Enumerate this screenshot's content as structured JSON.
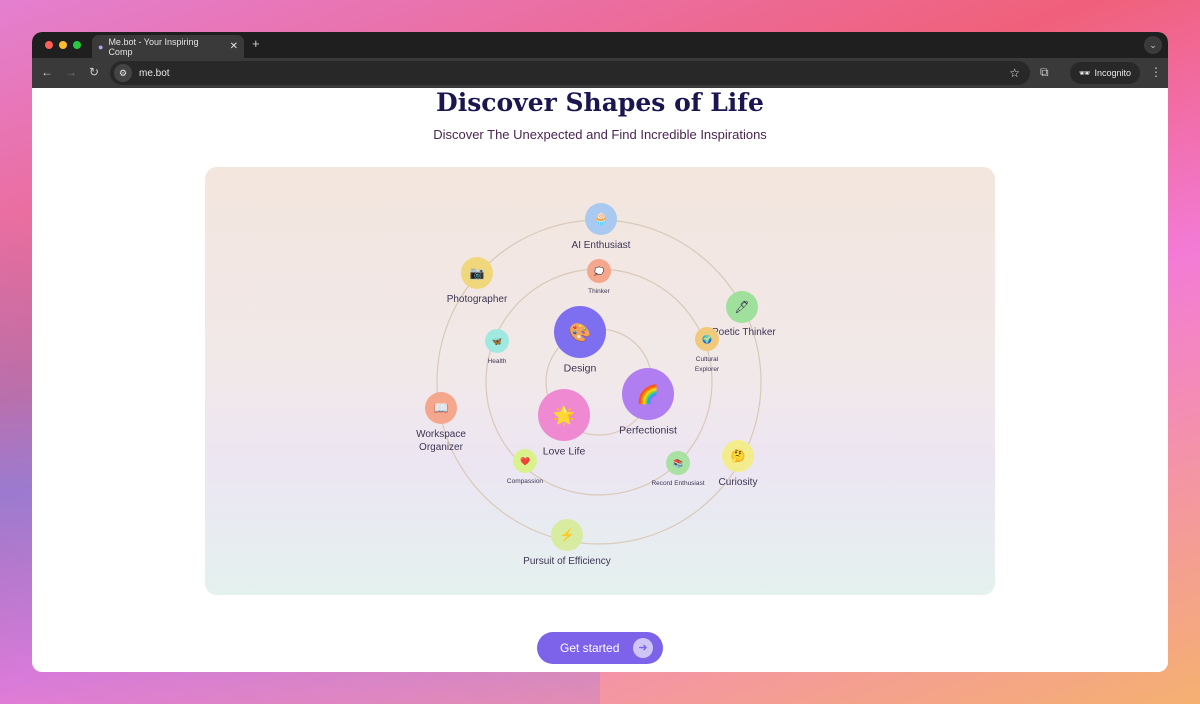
{
  "browser": {
    "tab_title": "Me.bot - Your Inspiring Comp",
    "url": "me.bot",
    "incognito_label": "Incognito"
  },
  "page": {
    "title": "Discover Shapes of Life",
    "subtitle": "Discover The Unexpected and Find Incredible Inspirations",
    "cta_label": "Get started"
  },
  "orbit": {
    "rings": [
      "inner",
      "middle",
      "outer"
    ],
    "nodes": [
      {
        "label": "AI Enthusiast",
        "icon": "🧁",
        "color": "#a9c9f0",
        "ring": "outer",
        "size": "medium"
      },
      {
        "label": "Photographer",
        "icon": "📷",
        "color": "#f1d77c",
        "ring": "outer",
        "size": "medium"
      },
      {
        "label": "Poetic Thinker",
        "icon": "🖋",
        "color": "#9fe09c",
        "ring": "outer",
        "size": "medium"
      },
      {
        "label": "Workspace Organizer",
        "icon": "📖",
        "color": "#f4a78c",
        "ring": "outer",
        "size": "medium"
      },
      {
        "label": "Curiosity",
        "icon": "🤔",
        "color": "#f3ec8c",
        "ring": "outer",
        "size": "medium"
      },
      {
        "label": "Pursuit of Efficiency",
        "icon": "⚡",
        "color": "#d7eca0",
        "ring": "outer",
        "size": "medium"
      },
      {
        "label": "Thinker",
        "icon": "💭",
        "color": "#f4a78c",
        "ring": "middle",
        "size": "small"
      },
      {
        "label": "Health",
        "icon": "🦋",
        "color": "#a0e9e0",
        "ring": "middle",
        "size": "small"
      },
      {
        "label": "Cultural Explorer",
        "icon": "🌍",
        "color": "#f1c97a",
        "ring": "middle",
        "size": "small"
      },
      {
        "label": "Compassion",
        "icon": "❤️",
        "color": "#daf28c",
        "ring": "middle",
        "size": "small"
      },
      {
        "label": "Record Enthusiast",
        "icon": "📚",
        "color": "#a9e1a2",
        "ring": "middle",
        "size": "small"
      },
      {
        "label": "Design",
        "icon": "🎨",
        "color": "#7e6ef0",
        "ring": "inner",
        "size": "large"
      },
      {
        "label": "Perfectionist",
        "icon": "🌈",
        "color": "#b07ef0",
        "ring": "inner",
        "size": "large"
      },
      {
        "label": "Love Life",
        "icon": "🌟",
        "color": "#ee89d2",
        "ring": "inner",
        "size": "large"
      }
    ]
  }
}
